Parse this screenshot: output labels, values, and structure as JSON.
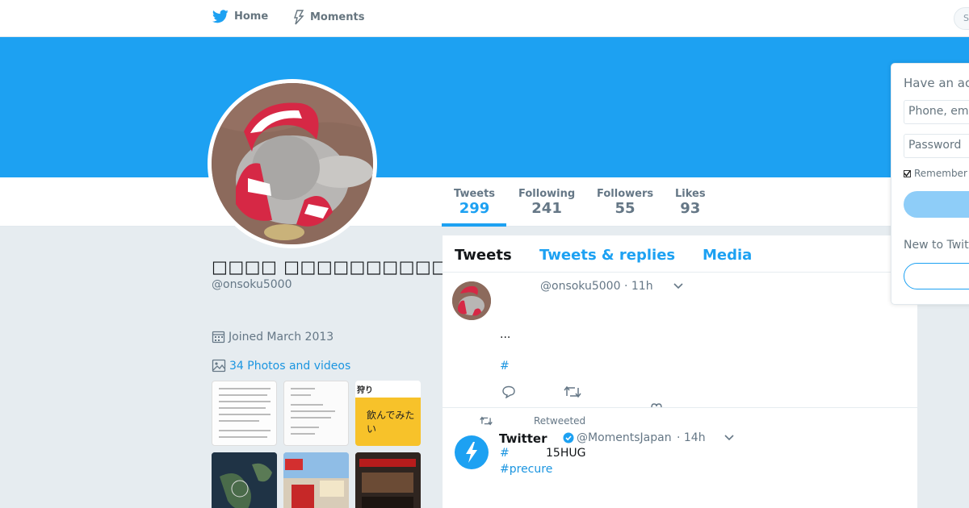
{
  "nav": {
    "home_label": "Home",
    "moments_label": "Moments",
    "search_placeholder": "S"
  },
  "profile": {
    "display_name": "□□□□ □□□□□□□□□□□",
    "handle": "@onsoku5000",
    "joined": "Joined March 2013",
    "photos_link": "34 Photos and videos"
  },
  "stats": [
    {
      "label": "Tweets",
      "value": "299"
    },
    {
      "label": "Following",
      "value": "241"
    },
    {
      "label": "Followers",
      "value": "55"
    },
    {
      "label": "Likes",
      "value": "93"
    }
  ],
  "thumbnails": {
    "hunt_text": "狩り",
    "drink_text": "飲んでみたい"
  },
  "timeline": {
    "tabs": [
      "Tweets",
      "Tweets & replies",
      "Media"
    ],
    "tweet1": {
      "handle": "@onsoku5000",
      "time": "· 11h",
      "text": "...",
      "hashtag": "#"
    },
    "tweet2": {
      "retweeted_label": "Retweeted",
      "name": "Twitter",
      "handle": "@MomentsJapan",
      "time": "· 14h",
      "hashtag": "#",
      "text": "15HUG",
      "hashtag2": "#precure"
    }
  },
  "login": {
    "title": "Have an account?",
    "phone_placeholder": "Phone, email or username",
    "password_placeholder": "Password",
    "remember_label": "Remember me",
    "new_to": "New to Twitter?"
  },
  "colors": {
    "brand": "#1da1f2",
    "link": "#1b95e0",
    "background": "#e6ecf0"
  }
}
